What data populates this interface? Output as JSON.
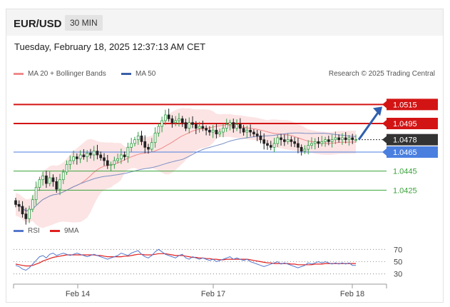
{
  "header": {
    "pair": "EUR/USD",
    "timeframe": "30 MIN"
  },
  "datetime": "Tuesday, February 18, 2025 12:37:13 AM CET",
  "legend": {
    "bollinger": {
      "label": "MA 20 + Bollinger Bands",
      "color": "#f08a8a"
    },
    "ma50": {
      "label": "MA 50",
      "color": "#3a5ea8"
    },
    "credit": "Research © 2025 Trading Central"
  },
  "rsi_legend": {
    "rsi": {
      "label": "RSI",
      "color": "#5577cc"
    },
    "ma9": {
      "label": "9MA",
      "color": "#e02020"
    }
  },
  "chart_data": [
    {
      "type": "candlestick",
      "ylim": [
        1.039,
        1.054
      ],
      "levels": [
        {
          "label": "1.0515",
          "value": 1.0515,
          "kind": "resistance",
          "color": "#d31414"
        },
        {
          "label": "1.0495",
          "value": 1.0495,
          "kind": "resistance",
          "color": "#d31414"
        },
        {
          "label": "1.0478",
          "value": 1.0478,
          "kind": "last-price",
          "color": "#333333"
        },
        {
          "label": "1.0465",
          "value": 1.0465,
          "kind": "pivot",
          "color": "#4a7fe0"
        },
        {
          "label": "1.0445",
          "value": 1.0445,
          "kind": "support",
          "color": "#3aa23a"
        },
        {
          "label": "1.0425",
          "value": 1.0425,
          "kind": "support",
          "color": "#3aa23a"
        }
      ],
      "x_ticks": [
        "Feb 14",
        "Feb 17",
        "Feb 18"
      ],
      "close": [
        1.041,
        1.0408,
        1.04,
        1.0395,
        1.0405,
        1.0415,
        1.0428,
        1.0436,
        1.044,
        1.0432,
        1.0438,
        1.0434,
        1.0426,
        1.0436,
        1.0444,
        1.0452,
        1.0456,
        1.046,
        1.0458,
        1.0462,
        1.046,
        1.0464,
        1.0462,
        1.0466,
        1.0462,
        1.0459,
        1.0456,
        1.0451,
        1.0452,
        1.0456,
        1.0458,
        1.0462,
        1.046,
        1.047,
        1.0474,
        1.0478,
        1.0482,
        1.0476,
        1.047,
        1.0468,
        1.0475,
        1.0485,
        1.0492,
        1.0498,
        1.0504,
        1.05,
        1.0496,
        1.0498,
        1.05,
        1.0496,
        1.049,
        1.0496,
        1.0494,
        1.049,
        1.0492,
        1.049,
        1.0488,
        1.0486,
        1.0488,
        1.0484,
        1.0486,
        1.049,
        1.0494,
        1.0496,
        1.049,
        1.0494,
        1.049,
        1.0486,
        1.0488,
        1.0486,
        1.0484,
        1.0482,
        1.0478,
        1.0474,
        1.0472,
        1.047,
        1.0474,
        1.048,
        1.0478,
        1.0476,
        1.0478,
        1.0476,
        1.0474,
        1.047,
        1.0466,
        1.0468,
        1.0472,
        1.0474,
        1.0476,
        1.0474,
        1.0476,
        1.0478,
        1.0476,
        1.0478,
        1.048,
        1.0478,
        1.048,
        1.0478,
        1.048,
        1.0478,
        1.0478
      ],
      "annotation": "projected rise toward 1.0515"
    },
    {
      "type": "line",
      "name": "RSI panel",
      "ylim": [
        25,
        75
      ],
      "y_ticks": [
        70,
        50,
        30
      ],
      "rsi": [
        44,
        42,
        38,
        36,
        40,
        46,
        52,
        58,
        60,
        56,
        62,
        64,
        60,
        62,
        64,
        62,
        60,
        62,
        64,
        62,
        60,
        58,
        60,
        62,
        60,
        58,
        56,
        54,
        56,
        58,
        60,
        64,
        62,
        60,
        64,
        66,
        68,
        62,
        58,
        56,
        60,
        66,
        70,
        66,
        62,
        60,
        58,
        56,
        60,
        62,
        56,
        54,
        58,
        56,
        54,
        56,
        54,
        52,
        54,
        50,
        52,
        54,
        56,
        58,
        54,
        56,
        54,
        52,
        54,
        50,
        48,
        46,
        44,
        42,
        44,
        46,
        48,
        50,
        46,
        48,
        46,
        44,
        42,
        40,
        42,
        44,
        48,
        46,
        48,
        50,
        48,
        50,
        48,
        46,
        48,
        46,
        48,
        46,
        48,
        44,
        44
      ],
      "ma9": [
        46,
        45,
        44,
        43,
        43,
        44,
        46,
        48,
        51,
        53,
        55,
        57,
        58,
        59,
        60,
        61,
        61,
        61,
        61,
        61,
        61,
        61,
        61,
        61,
        60,
        60,
        59,
        58,
        58,
        58,
        58,
        58,
        59,
        59,
        60,
        61,
        62,
        62,
        61,
        61,
        61,
        62,
        63,
        63,
        63,
        62,
        61,
        60,
        60,
        60,
        59,
        58,
        57,
        57,
        56,
        56,
        55,
        55,
        54,
        54,
        53,
        53,
        54,
        54,
        54,
        54,
        54,
        54,
        54,
        53,
        52,
        51,
        50,
        49,
        48,
        48,
        47,
        47,
        47,
        47,
        47,
        46,
        46,
        45,
        45,
        45,
        45,
        45,
        46,
        46,
        46,
        47,
        47,
        47,
        47,
        47,
        47,
        47,
        47,
        47,
        47
      ]
    }
  ]
}
